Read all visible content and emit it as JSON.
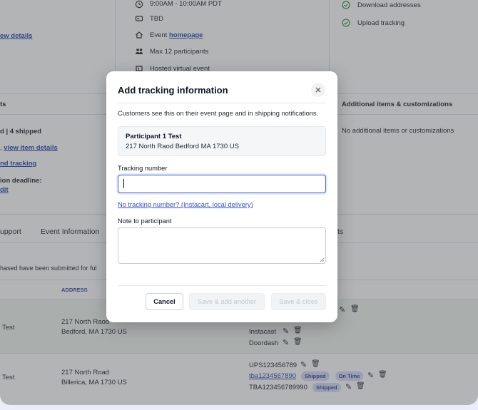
{
  "event_details": {
    "time": "9:00AM - 10:00AM PDT",
    "location": "TBD",
    "homepage_prefix": "Event",
    "homepage_link": "homepage",
    "capacity": "Max 12 participants",
    "format": "Hosted virtual event"
  },
  "left_column": {
    "view_details": "ew details",
    "section_head": "ts",
    "shipped_summary": "d | 4 shipped",
    "view_item_prefix": ",",
    "view_item_details": "view item details",
    "add_tracking": "nd tracking",
    "deadline": "ion deadline:",
    "edit": "dit"
  },
  "right_column": {
    "download_addresses": "Download addresses",
    "upload_tracking": "Upload tracking",
    "additional_heading": "Additional items & customizations",
    "additional_text": "No additional items or customizations"
  },
  "tabs": {
    "support": "upport",
    "event_information": "Event Information",
    "third": "ts"
  },
  "orders_note": "hased have been submitted for ful",
  "table": {
    "address_header": "ADDRESS",
    "rows": [
      {
        "name": "Test",
        "address_line1": "217 North Raod",
        "address_line2": "Bedford, MA 1730 US",
        "trackings": [
          "Instacast",
          "Doordash"
        ]
      },
      {
        "name": "Test",
        "address_line1": "217 North Road",
        "address_line2": "Billerica, MA 1730 US",
        "trackings": [
          "UPS123456789",
          "tba1234567890",
          "TBA123456789990"
        ]
      }
    ],
    "status_shipped": "Shipped",
    "status_on_time": "On Time"
  },
  "modal": {
    "title": "Add tracking information",
    "description": "Customers see this on their event page and in shipping notifications.",
    "participant_name": "Participant 1 Test",
    "participant_address": "217 North Raod Bedford MA 1730 US",
    "tracking_label": "Tracking number",
    "tracking_value": "",
    "no_tracking_link": "No tracking number? (Instacart, local delivery)",
    "note_label": "Note to participant",
    "note_value": "",
    "cancel": "Cancel",
    "save_add_another": "Save & add another",
    "save_close": "Save & close"
  },
  "colors": {
    "accent": "#3f5ed9",
    "link": "#3451c4",
    "overlay": "#37393f"
  }
}
